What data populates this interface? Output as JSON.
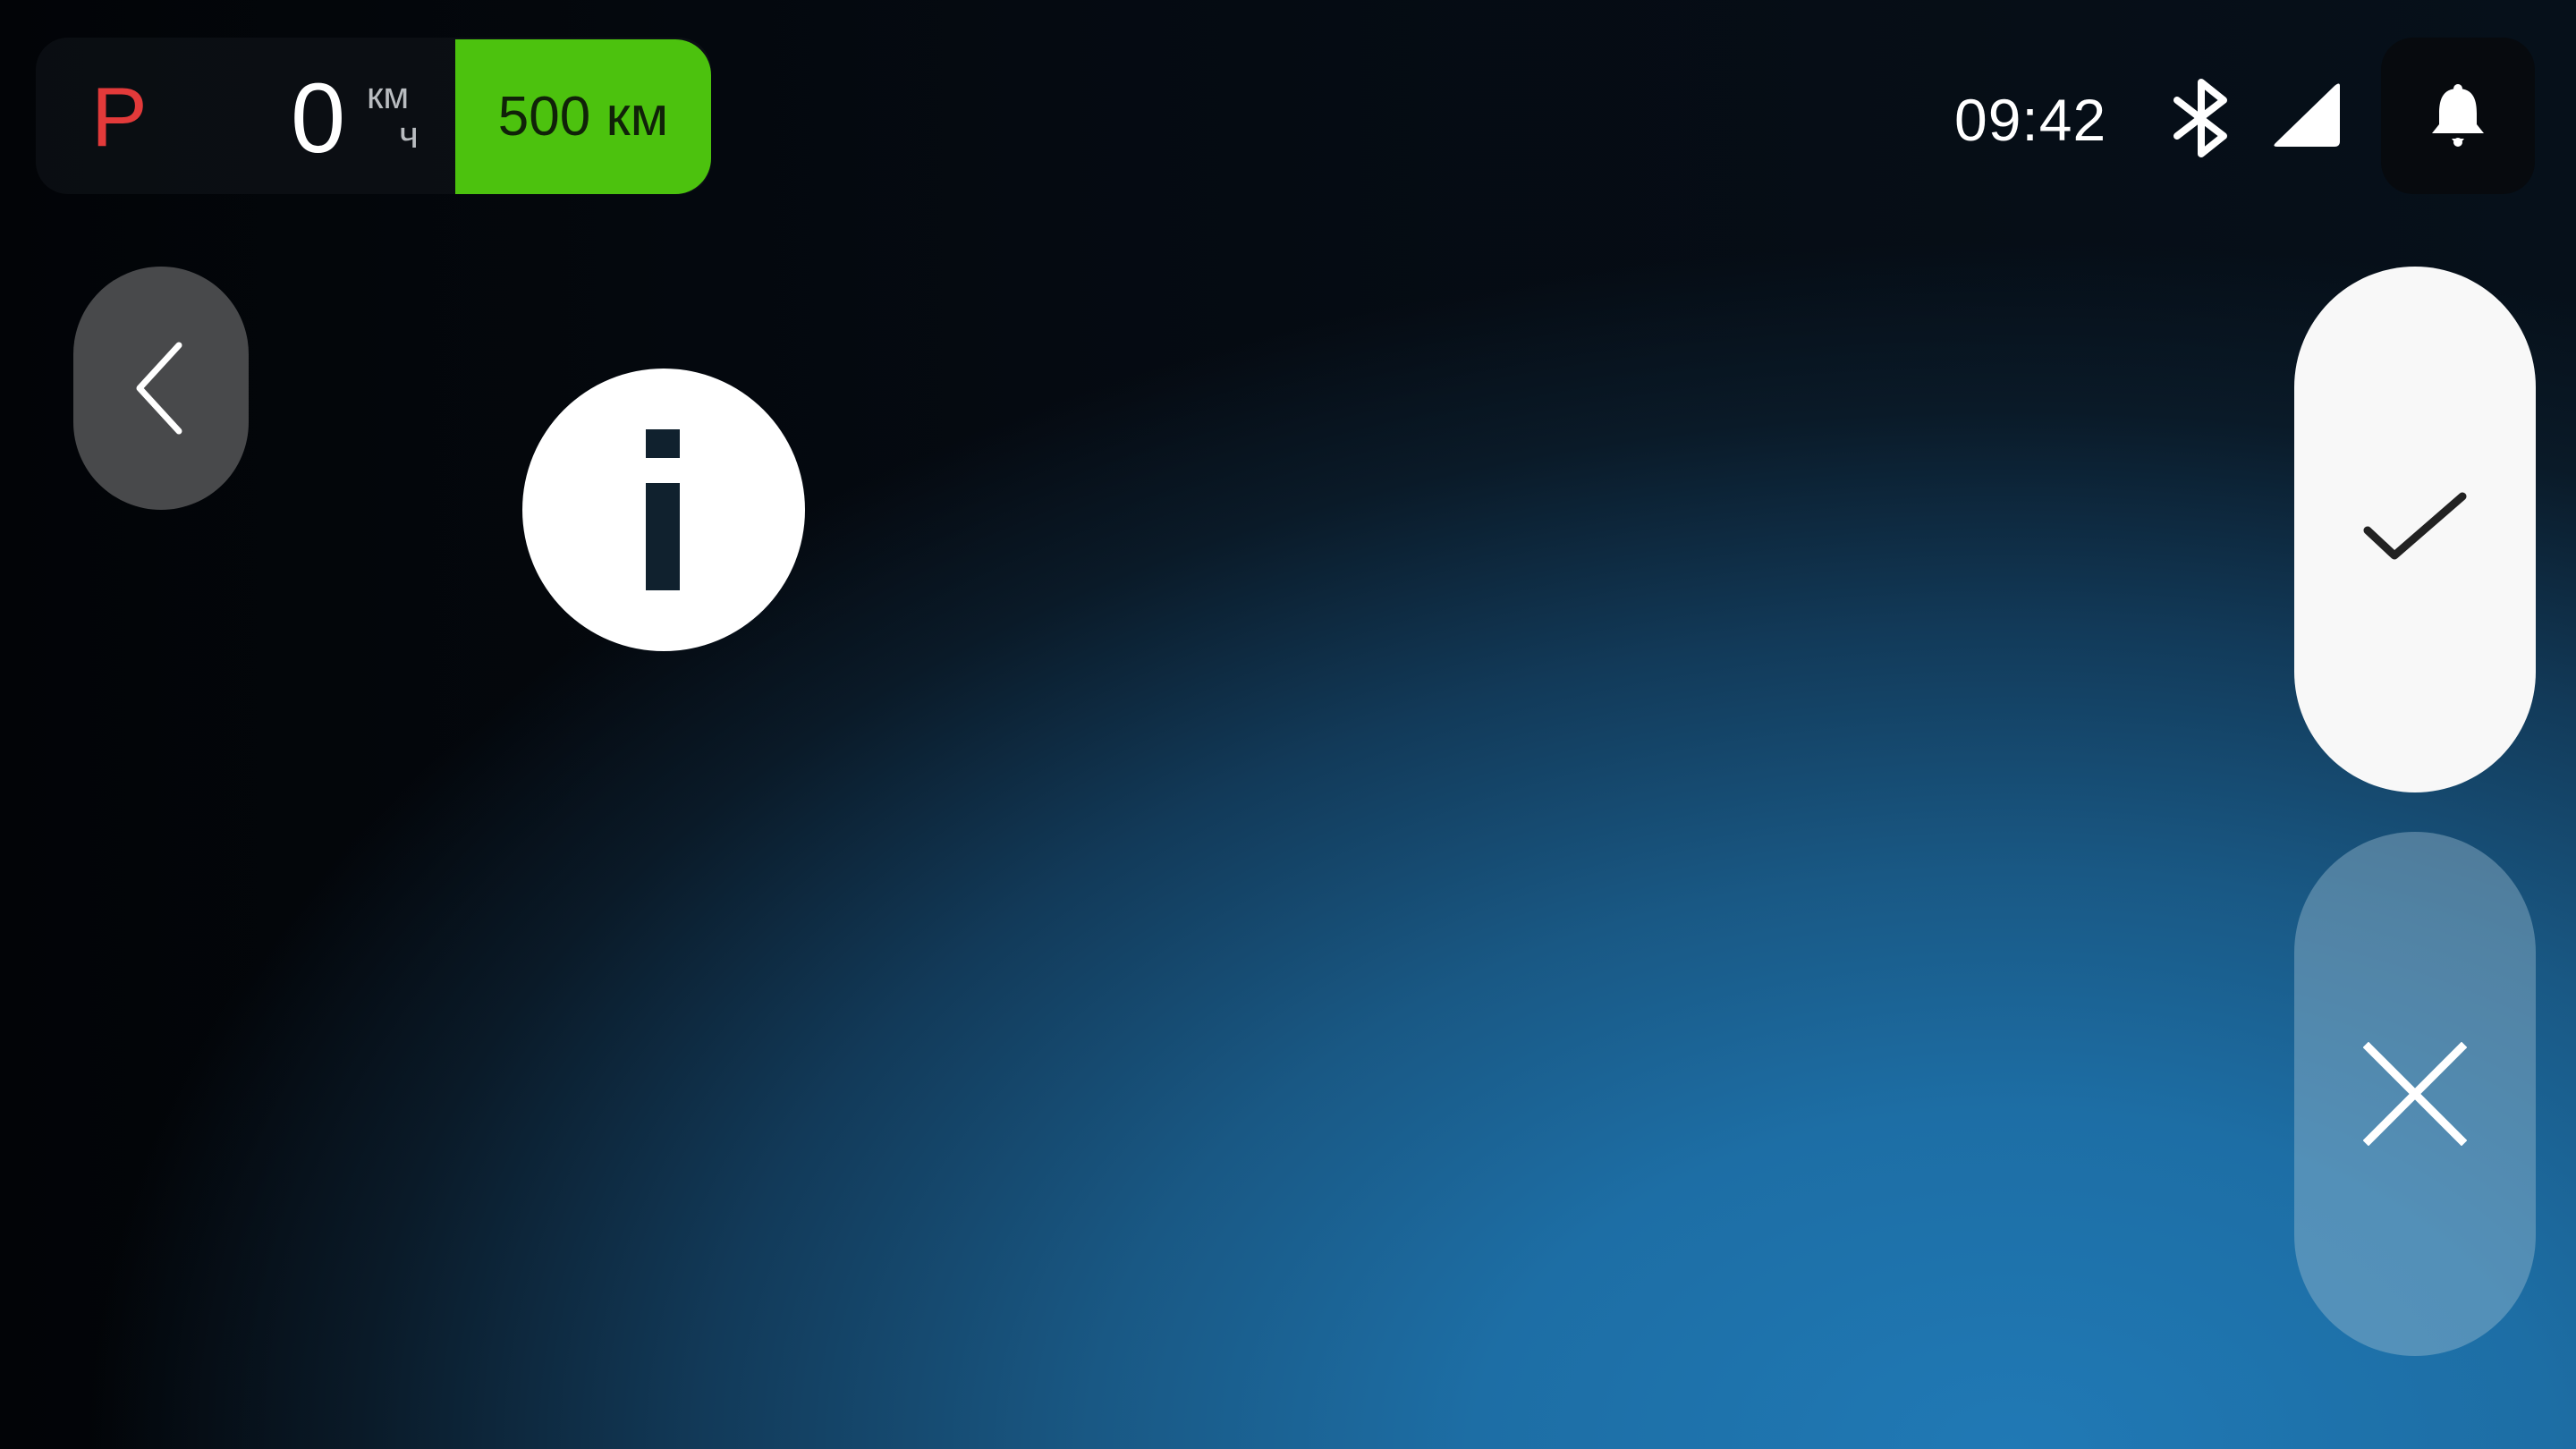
{
  "status_bar": {
    "gear": "P",
    "speed": "0",
    "speed_unit_top": "км",
    "speed_unit_bottom": "ч",
    "range": "500 км",
    "time": "09:42",
    "icons": [
      "bluetooth-icon",
      "signal-icon",
      "bell-icon"
    ]
  },
  "dialog": {
    "icon": "info-icon",
    "back_icon": "chevron-left-icon",
    "confirm_icon": "checkmark-icon",
    "cancel_icon": "close-icon"
  },
  "colors": {
    "gear": "#e33a3a",
    "range_badge": "#4cc20e",
    "background_accent": "#2079b5"
  }
}
